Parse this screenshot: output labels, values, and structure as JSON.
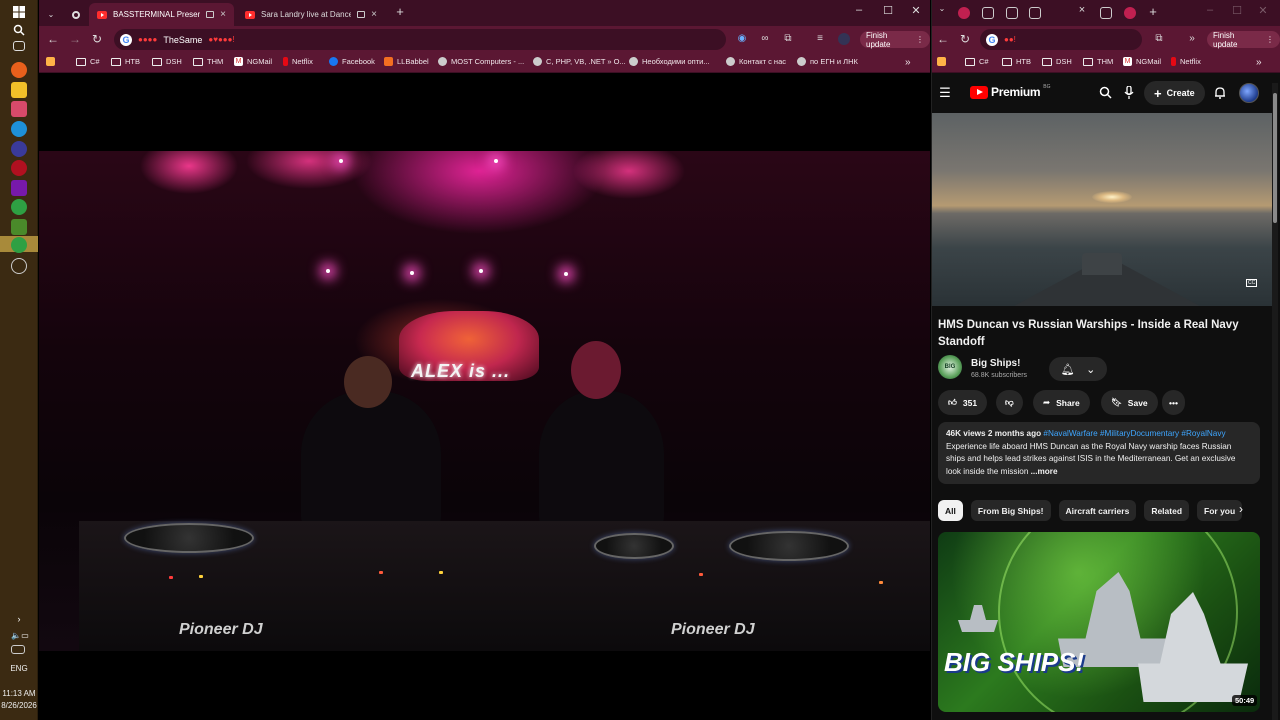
{
  "taskbar": {
    "time": "11:13 AM",
    "date": "8/26/2026",
    "lang": "ENG"
  },
  "left_window": {
    "tabs": [
      {
        "label": "BASSTERMINAL Presents: A"
      },
      {
        "label": "Sara Landry live at Dance A"
      }
    ],
    "address": "TheSame",
    "finish_update": "Finish update",
    "bookmarks": [
      {
        "label": "C#"
      },
      {
        "label": "НТВ"
      },
      {
        "label": "DSH"
      },
      {
        "label": "THM"
      },
      {
        "label": "NGMail"
      },
      {
        "label": "Netflix"
      },
      {
        "label": "Facebook"
      },
      {
        "label": "LLBabbel"
      },
      {
        "label": "MOST Computers - ..."
      },
      {
        "label": "C, PHP, VB, .NET » O..."
      },
      {
        "label": "Необходими опти..."
      },
      {
        "label": "Контакт с нас"
      },
      {
        "label": "по ЕГН и ЛНК"
      }
    ],
    "video": {
      "screen_text": "ALEX is ...",
      "deck_brand_left": "Pioneer DJ",
      "deck_brand_right": "Pioneer DJ"
    }
  },
  "right_window": {
    "finish_update": "Finish update",
    "bookmarks": [
      {
        "label": "C#"
      },
      {
        "label": "НТВ"
      },
      {
        "label": "DSH"
      },
      {
        "label": "THM"
      },
      {
        "label": "NGMail"
      },
      {
        "label": "Netflix"
      }
    ],
    "youtube": {
      "brand": "Premium",
      "region": "BG",
      "create_label": "Create",
      "video_title": "HMS Duncan vs Russian Warships - Inside a Real Navy Standoff",
      "channel_name": "Big Ships!",
      "channel_avatar_text": "BIG",
      "subscribers": "68.8K subscribers",
      "likes": "351",
      "share_label": "Share",
      "save_label": "Save",
      "views_meta": "46K views  2 months ago",
      "tags": "#NavalWarfare #MilitaryDocumentary #RoyalNavy",
      "description": "Experience life aboard HMS Duncan as the Royal Navy warship faces Russian ships and helps lead strikes against ISIS in the Mediterranean. Get an exclusive look inside the mission",
      "more_label": "...more",
      "chips": [
        {
          "label": "All",
          "selected": true
        },
        {
          "label": "From Big Ships!",
          "selected": false
        },
        {
          "label": "Aircraft carriers",
          "selected": false
        },
        {
          "label": "Related",
          "selected": false
        },
        {
          "label": "For you",
          "selected": false
        }
      ],
      "next_thumb_text": "BIG SHIPS!",
      "next_duration": "50:49"
    }
  },
  "colors": {
    "browser_frame": "#3c0f24",
    "browser_toolbar": "#5b1733",
    "youtube_bg": "#0f0f0f",
    "youtube_red": "#ff0000",
    "link_blue": "#3ea6ff",
    "taskbar": "#3b2a12"
  }
}
